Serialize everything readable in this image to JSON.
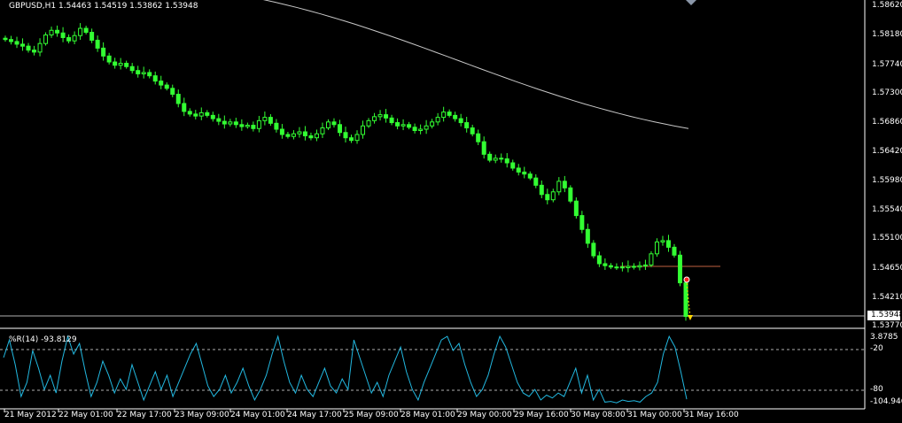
{
  "window": {
    "symbol_info": "GBPUSD,H1  1.54463 1.54519 1.53862 1.53948",
    "current_price": "1.53948"
  },
  "price_axis": [
    "1.58620",
    "1.58180",
    "1.57740",
    "1.57300",
    "1.56860",
    "1.56420",
    "1.55980",
    "1.55540",
    "1.55100",
    "1.54650",
    "1.54210",
    "1.53770"
  ],
  "indicator": {
    "label": "%R(14) -93.8129",
    "axis_labels": [
      "3.8785",
      "-20",
      "-80",
      "-104.946"
    ]
  },
  "time_axis": [
    "21 May 2012",
    "22 May 01:00",
    "22 May 17:00",
    "23 May 09:00",
    "24 May 01:00",
    "24 May 17:00",
    "25 May 09:00",
    "28 May 01:00",
    "29 May 00:00",
    "29 May 16:00",
    "30 May 08:00",
    "31 May 00:00",
    "31 May 16:00"
  ],
  "colors": {
    "background": "#000000",
    "candles": "#33ff33",
    "moving_average": "#c8c8c8",
    "indicator_line": "#22b8e0",
    "horizontal_line": "#c06040",
    "grid_levels": "#b0b0b0"
  },
  "chart_data": {
    "type": "candlestick",
    "symbol": "GBPUSD",
    "timeframe": "H1",
    "ohlc": {
      "open": 1.54463,
      "high": 1.54519,
      "low": 1.53862,
      "close": 1.53948
    },
    "ylim": [
      1.5377,
      1.5875
    ],
    "close_path": [
      1.5815,
      1.5812,
      1.5808,
      1.5805,
      1.5799,
      1.5796,
      1.5809,
      1.5822,
      1.5829,
      1.5825,
      1.5818,
      1.5813,
      1.5821,
      1.5832,
      1.5826,
      1.5814,
      1.5802,
      1.579,
      1.5781,
      1.5776,
      1.5779,
      1.5774,
      1.5768,
      1.5763,
      1.5765,
      1.576,
      1.5752,
      1.5746,
      1.5741,
      1.5732,
      1.5718,
      1.5706,
      1.5702,
      1.5699,
      1.5704,
      1.57,
      1.5695,
      1.5691,
      1.5687,
      1.569,
      1.5686,
      1.5683,
      1.5685,
      1.568,
      1.5692,
      1.5697,
      1.5688,
      1.5679,
      1.5671,
      1.5668,
      1.5672,
      1.5675,
      1.5669,
      1.5666,
      1.5672,
      1.5681,
      1.569,
      1.5686,
      1.5674,
      1.5666,
      1.5662,
      1.5671,
      1.5684,
      1.5692,
      1.5698,
      1.5701,
      1.5696,
      1.5689,
      1.5684,
      1.5686,
      1.5682,
      1.5677,
      1.5679,
      1.5684,
      1.569,
      1.5697,
      1.5705,
      1.57,
      1.5695,
      1.5689,
      1.5681,
      1.5672,
      1.566,
      1.5641,
      1.5632,
      1.5635,
      1.5634,
      1.5628,
      1.562,
      1.5614,
      1.5611,
      1.5605,
      1.5594,
      1.558,
      1.5572,
      1.5584,
      1.56,
      1.559,
      1.557,
      1.5548,
      1.5527,
      1.5506,
      1.5487,
      1.5475,
      1.5472,
      1.547,
      1.547,
      1.5469,
      1.5471,
      1.547,
      1.5472,
      1.5473,
      1.549,
      1.5508,
      1.551,
      1.55,
      1.5488,
      1.5446,
      1.5395
    ],
    "moving_average": {
      "start": 1.5886,
      "end": 1.568
    },
    "indicator": {
      "name": "%R(14)",
      "last": -93.8129,
      "levels": [
        -20,
        -80
      ],
      "ylim": [
        -104.946,
        3.8785
      ],
      "values": [
        -35,
        -10,
        -45,
        -90,
        -70,
        -25,
        -50,
        -80,
        -60,
        -85,
        -40,
        -5,
        -30,
        -15,
        -55,
        -90,
        -70,
        -40,
        -60,
        -85,
        -65,
        -80,
        -45,
        -70,
        -95,
        -75,
        -55,
        -80,
        -60,
        -90,
        -70,
        -50,
        -30,
        -15,
        -45,
        -75,
        -90,
        -80,
        -60,
        -85,
        -70,
        -50,
        -75,
        -95,
        -80,
        -60,
        -30,
        -5,
        -40,
        -70,
        -85,
        -60,
        -80,
        -90,
        -70,
        -50,
        -75,
        -85,
        -65,
        -80,
        -10,
        -35,
        -60,
        -85,
        -70,
        -90,
        -60,
        -40,
        -20,
        -55,
        -80,
        -95,
        -70,
        -50,
        -30,
        -10,
        -5,
        -25,
        -15,
        -45,
        -70,
        -90,
        -80,
        -60,
        -30,
        -5,
        -20,
        -45,
        -70,
        -85,
        -90,
        -80,
        -95,
        -88,
        -92,
        -85,
        -90,
        -70,
        -50,
        -85,
        -60,
        -95,
        -80,
        -98,
        -97,
        -99,
        -95,
        -97,
        -96,
        -98,
        -90,
        -85,
        -70,
        -30,
        -5,
        -20,
        -55,
        -93.8
      ]
    },
    "horizontal_line": 1.5467,
    "grid_line": 1.5395
  }
}
